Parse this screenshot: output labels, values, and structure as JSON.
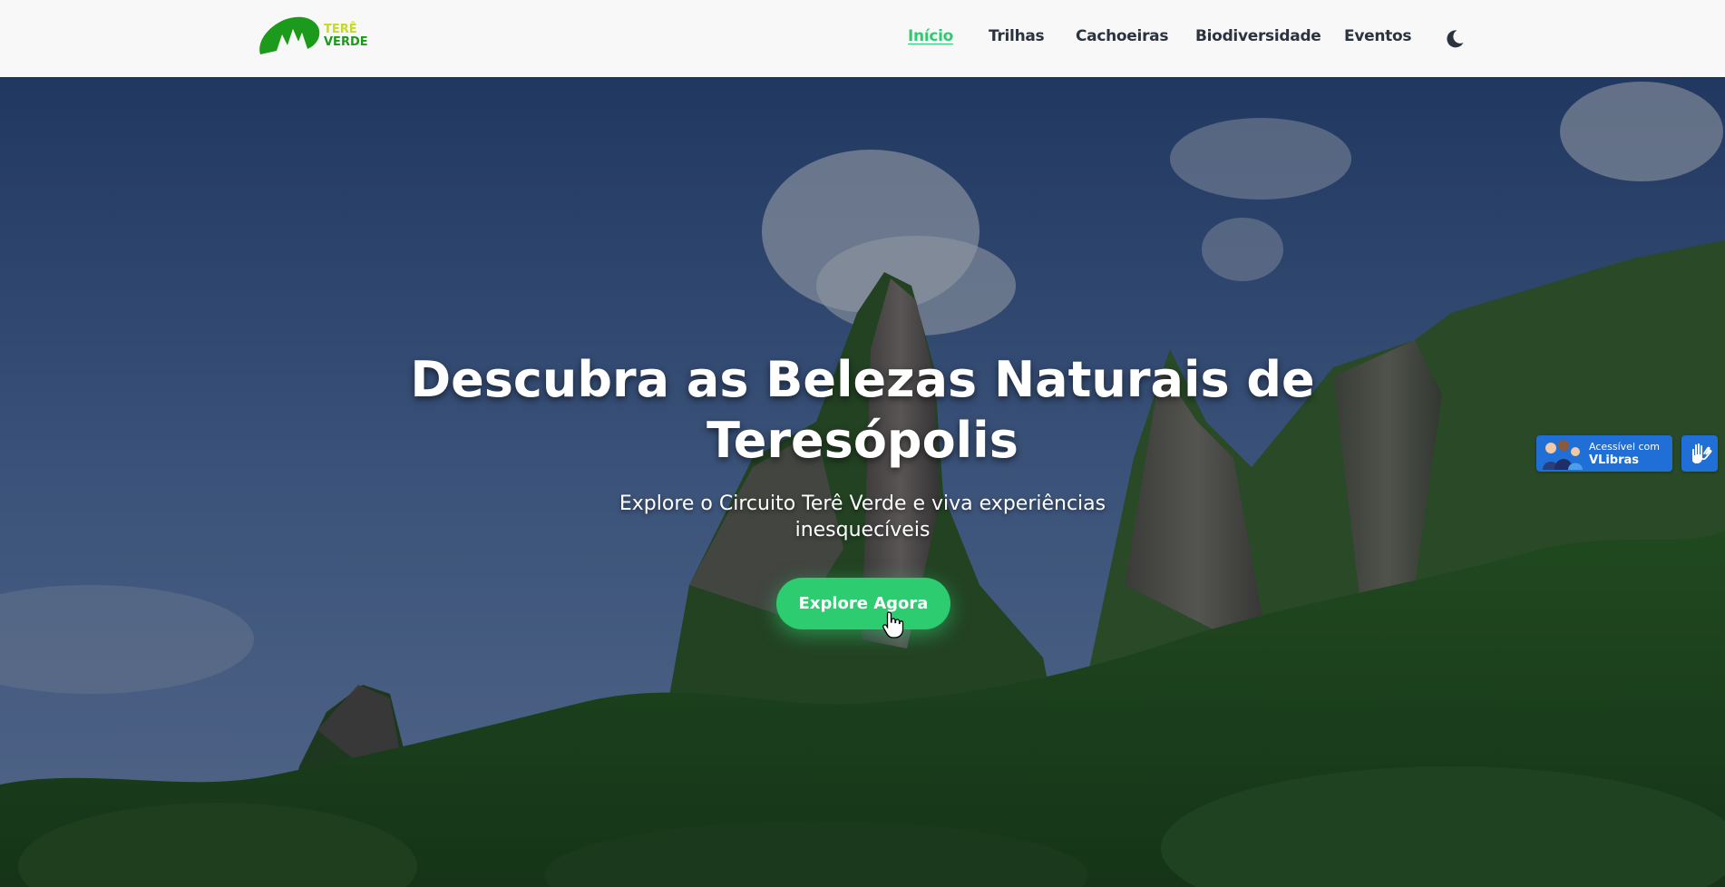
{
  "header": {
    "logo": {
      "line1": "TERÊ",
      "line2": "VERDE"
    },
    "nav": [
      {
        "label": "Início",
        "active": true
      },
      {
        "label": "Trilhas",
        "active": false
      },
      {
        "label": "Cachoeiras",
        "active": false
      },
      {
        "label": "Biodiversidade",
        "active": false
      },
      {
        "label": "Eventos",
        "active": false
      }
    ],
    "theme_toggle_icon": "moon-icon"
  },
  "hero": {
    "title_line1": "Descubra as Belezas Naturais de",
    "title_line2": "Teresópolis",
    "subtitle_line1": "Explore o Circuito Terê Verde e viva experiências",
    "subtitle_line2": "inesquecíveis",
    "cta_label": "Explore Agora"
  },
  "vlibras": {
    "line1": "Acessível com",
    "line2": "VLibras",
    "icon": "hands-icon"
  },
  "colors": {
    "accent": "#2ecc71",
    "nav_text": "#2c3340",
    "header_bg": "#f8f8f8",
    "logo_green": "#1c9a1c",
    "logo_lime": "#c6d82a",
    "vlibras_blue": "#1f6fd6"
  }
}
